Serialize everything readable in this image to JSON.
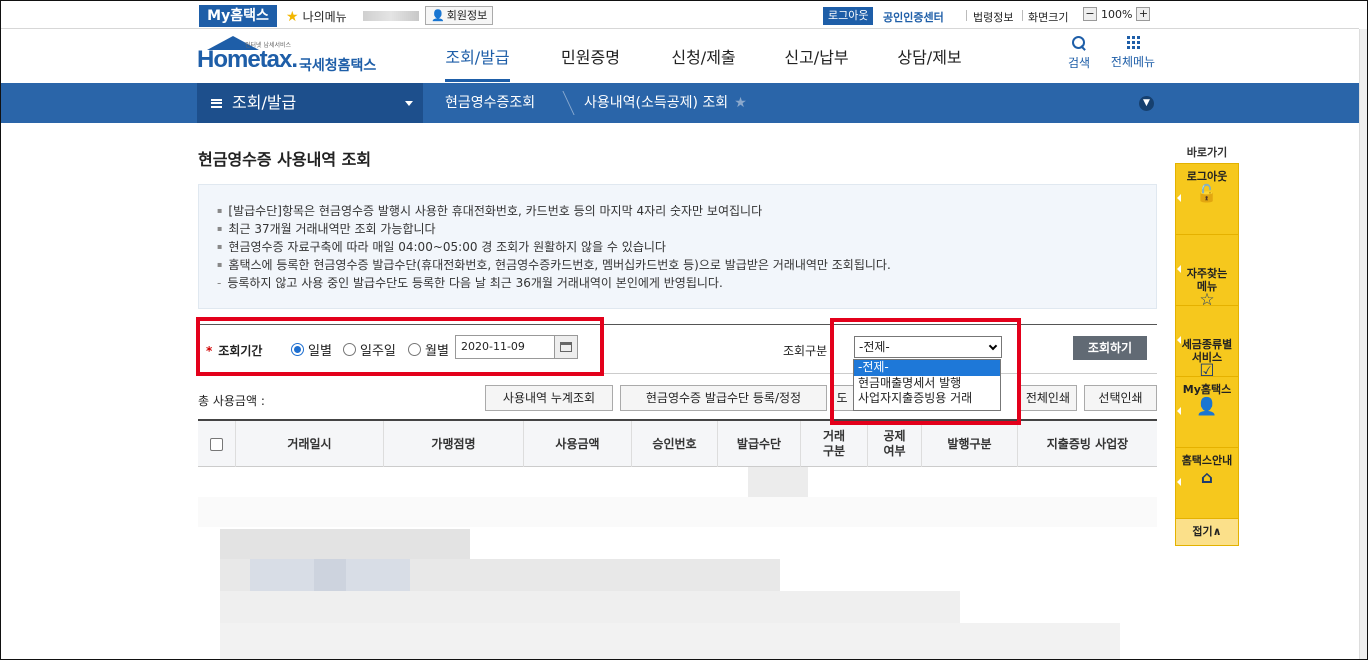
{
  "topbar": {
    "mytax_tab": "My홈택스",
    "my_menu": "나의메뉴",
    "member_info": "회원정보",
    "logout": "로그아웃",
    "cert_center": "공인인증센터",
    "law_info": "법령정보",
    "screen_size": "화면크기",
    "zoom_minus": "−",
    "zoom_value": "100%",
    "zoom_plus": "+"
  },
  "header": {
    "logo_sub": "인터넷 납세서비스",
    "logo_home": "Hometax.",
    "logo_name": "국세청홈택스",
    "nav": [
      {
        "label": "조회/발급",
        "active": true
      },
      {
        "label": "민원증명"
      },
      {
        "label": "신청/제출"
      },
      {
        "label": "신고/납부"
      },
      {
        "label": "상담/제보"
      }
    ],
    "search": "검색",
    "all_menu": "전체메뉴"
  },
  "breadcrumb": {
    "main": "조회/발급",
    "item1": "현금영수증조회",
    "item2": "사용내역(소득공제) 조회"
  },
  "page": {
    "title": "현금영수증 사용내역 조회",
    "notices": [
      "[발급수단]항목은 현금영수증 발행시 사용한 휴대전화번호, 카드번호 등의 마지막 4자리 숫자만 보여집니다",
      "최근 37개월 거래내역만 조회 가능합니다",
      "현금영수증 자료구축에 따라 매일 04:00~05:00 경 조회가 원활하지 않을 수 있습니다",
      "홈택스에 등록한 현금영수증 발급수단(휴대전화번호, 현금영수증카드번호, 멤버십카드번호 등)으로 발급받은 거래내역만 조회됩니다.",
      "등록하지 않고 사용 중인 발급수단도 등록한 다음 날 최근 36개월 거래내역이 본인에게 반영됩니다."
    ]
  },
  "search": {
    "required_mark": "*",
    "period_label": "조회기간",
    "radios": [
      {
        "label": "일별",
        "checked": true
      },
      {
        "label": "일주일",
        "checked": false
      },
      {
        "label": "월별",
        "checked": false
      }
    ],
    "date": "2020-11-09",
    "kind_label": "조회구분",
    "select_value": "-전제-",
    "options": [
      "-전제-",
      "현금매출명세서 발행",
      "사업자지출증빙용 거래"
    ],
    "query_button": "조회하기"
  },
  "actions": {
    "total_label": "총 사용금액 :",
    "cumulative": "사용내역 누계조회",
    "register": "현금영수증 발급수단 등록/정정",
    "download": "도",
    "print_all": "전체인쇄",
    "print_selected": "선택인쇄"
  },
  "table": {
    "headers": [
      "거래일시",
      "가맹점명",
      "사용금액",
      "승인번호",
      "발급수단",
      "거래\n구분",
      "공제\n여부",
      "발행구분",
      "지출증빙 사업장"
    ]
  },
  "quick": {
    "title": "바로가기",
    "items": [
      "로그아웃",
      "자주찾는\n메뉴",
      "세금종류별\n서비스",
      "My홈택스",
      "홈택스안내"
    ],
    "fold": "접기∧"
  },
  "colors": {
    "brand_blue": "#1e5ea8",
    "highlight_red": "#e3001b",
    "quick_yellow": "#f6c81d"
  }
}
